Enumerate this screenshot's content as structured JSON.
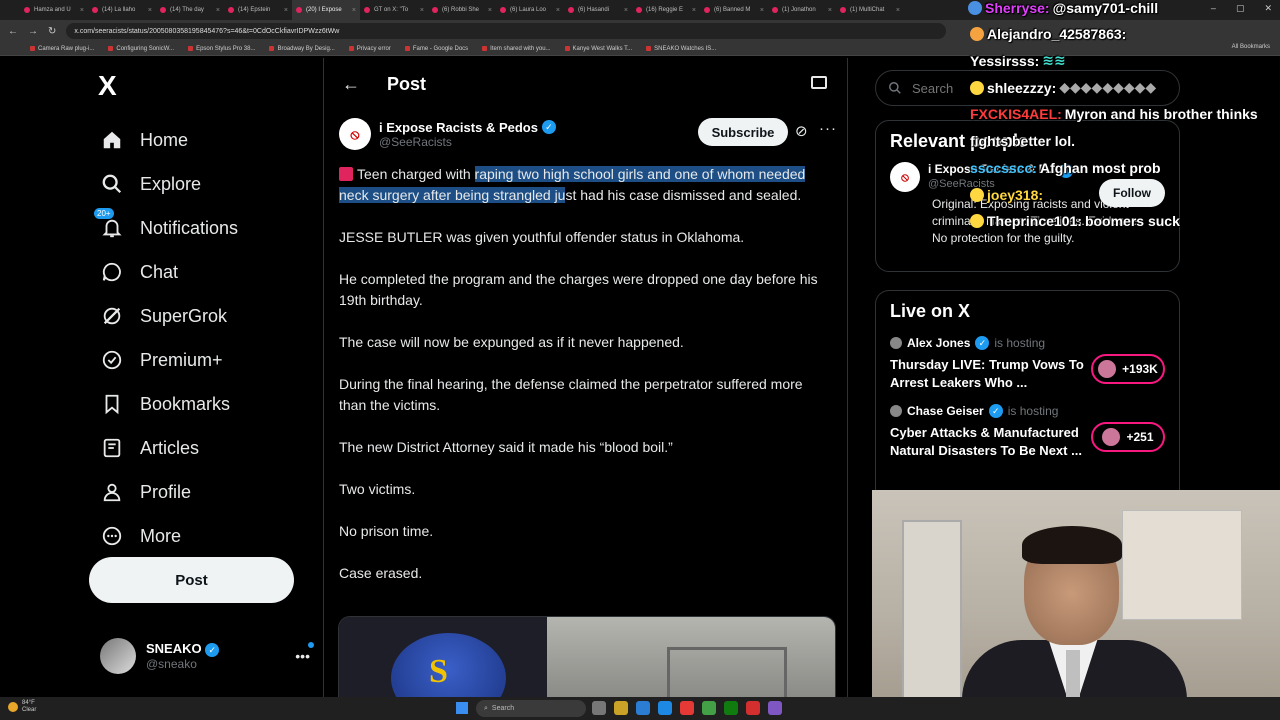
{
  "browser": {
    "tabs": [
      "Hamza and U",
      "(14) La llaho",
      "(14) The day",
      "(14) Epstein",
      "(20) I Expose",
      "GT on X: \"To",
      "(6) Robbi She",
      "(6) Laura Loo",
      "(6) Hasandi",
      "(16) Reggie E",
      "(6) Banned M",
      "(1) Jonathon",
      "(1) MultiChat"
    ],
    "active_tab_index": 4,
    "url": "x.com/seeracists/status/2005080358195845476?s=46&t=0CdOcCkfiavrIDPWzz6tWw",
    "bookmarks": [
      "Camera Raw plug-i...",
      "Configuring SonicW...",
      "Epson Stylus Pro 38...",
      "Broadway By Desig...",
      "Privacy error",
      "Fame - Google Docs",
      "Item shared with you...",
      "Kanye West Walks T...",
      "SNEAKO Watches IS..."
    ],
    "all_bookmarks_label": "All Bookmarks"
  },
  "sidebar": {
    "logo": "X",
    "items": [
      {
        "label": "Home",
        "icon": "home-icon"
      },
      {
        "label": "Explore",
        "icon": "search-icon"
      },
      {
        "label": "Notifications",
        "icon": "bell-icon",
        "badge": "20+"
      },
      {
        "label": "Chat",
        "icon": "chat-icon"
      },
      {
        "label": "SuperGrok",
        "icon": "grok-icon"
      },
      {
        "label": "Premium+",
        "icon": "premium-icon"
      },
      {
        "label": "Bookmarks",
        "icon": "bookmark-icon"
      },
      {
        "label": "Articles",
        "icon": "articles-icon"
      },
      {
        "label": "Profile",
        "icon": "person-icon"
      },
      {
        "label": "More",
        "icon": "more-circle-icon"
      }
    ],
    "post_button": "Post",
    "account": {
      "name": "SNEAKO",
      "handle": "@sneako"
    }
  },
  "main": {
    "header_title": "Post",
    "author": {
      "name": "i Expose Racists & Pedos",
      "handle": "@SeeRacists"
    },
    "subscribe_label": "Subscribe",
    "post": {
      "p1_pre": "Teen charged with ",
      "p1_highlight": "raping two high school girls and one of whom needed neck surgery after being strangled ju",
      "p1_post": "st had his case dismissed and sealed.",
      "paragraphs": [
        "JESSE BUTLER was given youthful offender status in Oklahoma.",
        "He completed the program and the charges were dropped one day before his 19th birthday.",
        "The case will now be expunged as if it never happened.",
        "During the final hearing, the defense claimed the perpetrator suffered more than the victims.",
        "The new District Attorney said it made his “blood boil.”",
        "Two victims.",
        "No prison time.",
        "Case erased."
      ],
      "media_letter": "S"
    }
  },
  "right": {
    "search_placeholder": "Search",
    "relevant": {
      "title": "Relevant people",
      "name": "i Expose Racists & P...",
      "handle": "@SeeRacists",
      "follow_label": "Follow",
      "bio_lines": [
        "Original: Exposing racists and violent",
        "criminals. Names. Timelines. Evidence.",
        "No protection for the guilty."
      ]
    },
    "live": {
      "title": "Live on X",
      "is_hosting": "is hosting",
      "items": [
        {
          "host": "Alex Jones",
          "title": "Thursday LIVE: Trump Vows To Arrest Leakers Who ...",
          "count": "+193K"
        },
        {
          "host": "Chase Geiser",
          "title": "Cyber Attacks & Manufactured Natural Disasters To Be Next ...",
          "count": "+251"
        }
      ]
    }
  },
  "chat": {
    "lines": [
      {
        "user": "Sherryse:",
        "text": "@samy701-chill",
        "color": "#e040fb"
      },
      {
        "user": "Alejandro_42587863:",
        "text": "",
        "color": "#ffffff"
      },
      {
        "user": "Yessirsss:",
        "text": "",
        "color": "#ffffff"
      },
      {
        "user": "shleezzzy:",
        "text": "",
        "color": "#ffffff"
      },
      {
        "user": "FXCKIS4AEL:",
        "text": "Myron and his brother thinks",
        "color": "#ff3b3b"
      },
      {
        "user": "",
        "text": "fights better lol.",
        "color": "#ffffff"
      },
      {
        "user": "ssccsscc:",
        "text": "Afghan most prob",
        "color": "#40c4ff"
      },
      {
        "user": "joey318:",
        "text": "",
        "color": "#ffd740"
      },
      {
        "user": "Theprince101:",
        "text": "boomers suck",
        "color": "#ffffff"
      }
    ]
  },
  "taskbar": {
    "weather_temp": "84°F",
    "weather_desc": "Clear",
    "search_label": "Search"
  },
  "colors": {
    "accent": "#1d9bf0",
    "live_pink": "#f91880",
    "highlight": "#1d4f86"
  }
}
